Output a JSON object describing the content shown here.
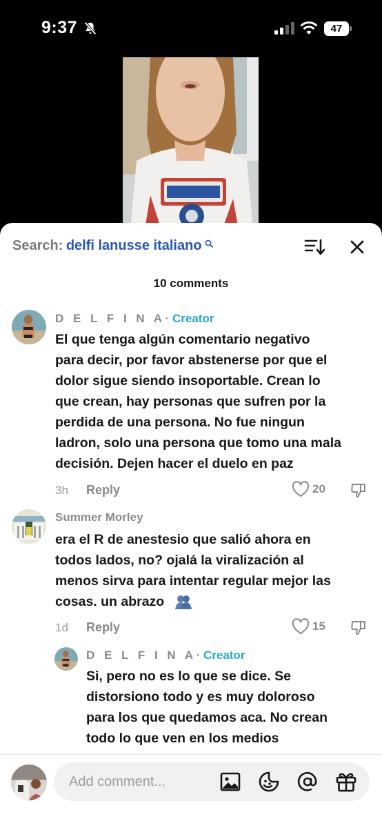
{
  "status": {
    "time": "9:37",
    "battery": "47"
  },
  "search": {
    "prefix": "Search:",
    "term": "delfi lanusse italiano"
  },
  "comments_header": {
    "count_label": "10 comments"
  },
  "comments": [
    {
      "author": "D E L F I N A",
      "separator": "·",
      "badge": "Creator",
      "lines": [
        "El que tenga algún comentario negativo",
        "para decir, por favor abstenerse por que el",
        "dolor sigue siendo insoportable. Crean lo",
        "que crean, hay personas que sufren por la",
        "perdida de una persona. No fue ningun",
        "ladron, solo una persona que tomo una mala",
        "decisión. Dejen hacer el duelo en paz"
      ],
      "time": "3h",
      "reply": "Reply",
      "likes": "20"
    },
    {
      "author": "Summer Morley",
      "lines": [
        "era el R de anestesio que salió ahora en",
        "todos lados, no? ojalá la viralización al",
        "menos sirva para intentar regular mejor las",
        "cosas. un abrazo"
      ],
      "time": "1d",
      "reply": "Reply",
      "likes": "15"
    },
    {
      "author": "D E L F I N A",
      "separator": "·",
      "badge": "Creator",
      "lines": [
        "Si, pero no es lo que se dice. Se",
        "distorsiono todo y es muy doloroso",
        "para los que quedamos aca. No crean",
        "todo lo que ven en los medios"
      ]
    }
  ],
  "composer": {
    "placeholder": "Add comment..."
  },
  "icons": {
    "status": [
      "bell-slash-icon",
      "signal-icon",
      "wifi-icon",
      "battery-icon"
    ],
    "sheet": [
      "search-icon",
      "sort-icon",
      "close-icon",
      "heart-icon",
      "dislike-icon",
      "hug-emoji-icon"
    ],
    "composer": [
      "image-icon",
      "emoji-icon",
      "mention-icon",
      "gift-icon"
    ]
  },
  "colors": {
    "search_term": "#2856b5",
    "creator_badge": "#25a8c8",
    "muted": "#8a8a8a",
    "text": "#161616"
  }
}
